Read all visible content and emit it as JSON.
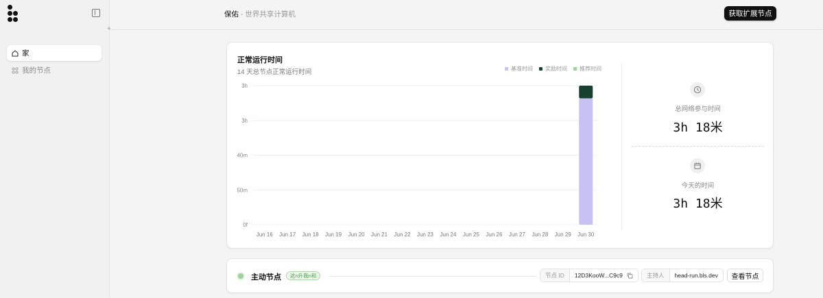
{
  "sidebar": {
    "items": [
      {
        "label": "家",
        "icon": "home-icon",
        "active": true
      },
      {
        "label": "我的节点",
        "icon": "nodes-icon",
        "active": false
      }
    ]
  },
  "header": {
    "brand": "保佑",
    "subtitle": " - 世界共享计算机",
    "extension_button": "获取扩展节点"
  },
  "uptime": {
    "title": "正常运行时间",
    "subtitle": "14 天总节点正常运行时间",
    "stats": [
      {
        "label": "总网络参与时间",
        "value": "3h 18米",
        "icon": "clock-icon"
      },
      {
        "label": "今天的时间",
        "value": "3h 18米",
        "icon": "calendar-icon"
      }
    ]
  },
  "chart_data": {
    "type": "bar",
    "stacked": true,
    "categories": [
      "Jun 16",
      "Jun 17",
      "Jun 18",
      "Jun 19",
      "Jun 20",
      "Jun 21",
      "Jun 22",
      "Jun 23",
      "Jun 24",
      "Jun 25",
      "Jun 26",
      "Jun 27",
      "Jun 28",
      "Jun 29",
      "Jun 30"
    ],
    "y_tick_labels": [
      "3h",
      "3h",
      "40m",
      "50m",
      "0f"
    ],
    "ylim": [
      0,
      198
    ],
    "series": [
      {
        "name": "基准时间",
        "color": "#c8c1f4",
        "values": [
          0,
          0,
          0,
          0,
          0,
          0,
          0,
          0,
          0,
          0,
          0,
          0,
          0,
          0,
          180
        ]
      },
      {
        "name": "奖励时间",
        "color": "#17402e",
        "values": [
          0,
          0,
          0,
          0,
          0,
          0,
          0,
          0,
          0,
          0,
          0,
          0,
          0,
          0,
          18
        ]
      },
      {
        "name": "推荐时间",
        "color": "#9bd39a",
        "values": [
          0,
          0,
          0,
          0,
          0,
          0,
          0,
          0,
          0,
          0,
          0,
          0,
          0,
          0,
          0
        ]
      }
    ],
    "legend_position": "top-right",
    "grid": true
  },
  "node": {
    "title": "主动节点",
    "badge": "这n升我n和",
    "id_label": "节点 ID",
    "id_value": "12D3KooW...C9c9",
    "host_label": "主持人",
    "host_value": "head-run.bls.dev",
    "view_button": "查看节点"
  }
}
